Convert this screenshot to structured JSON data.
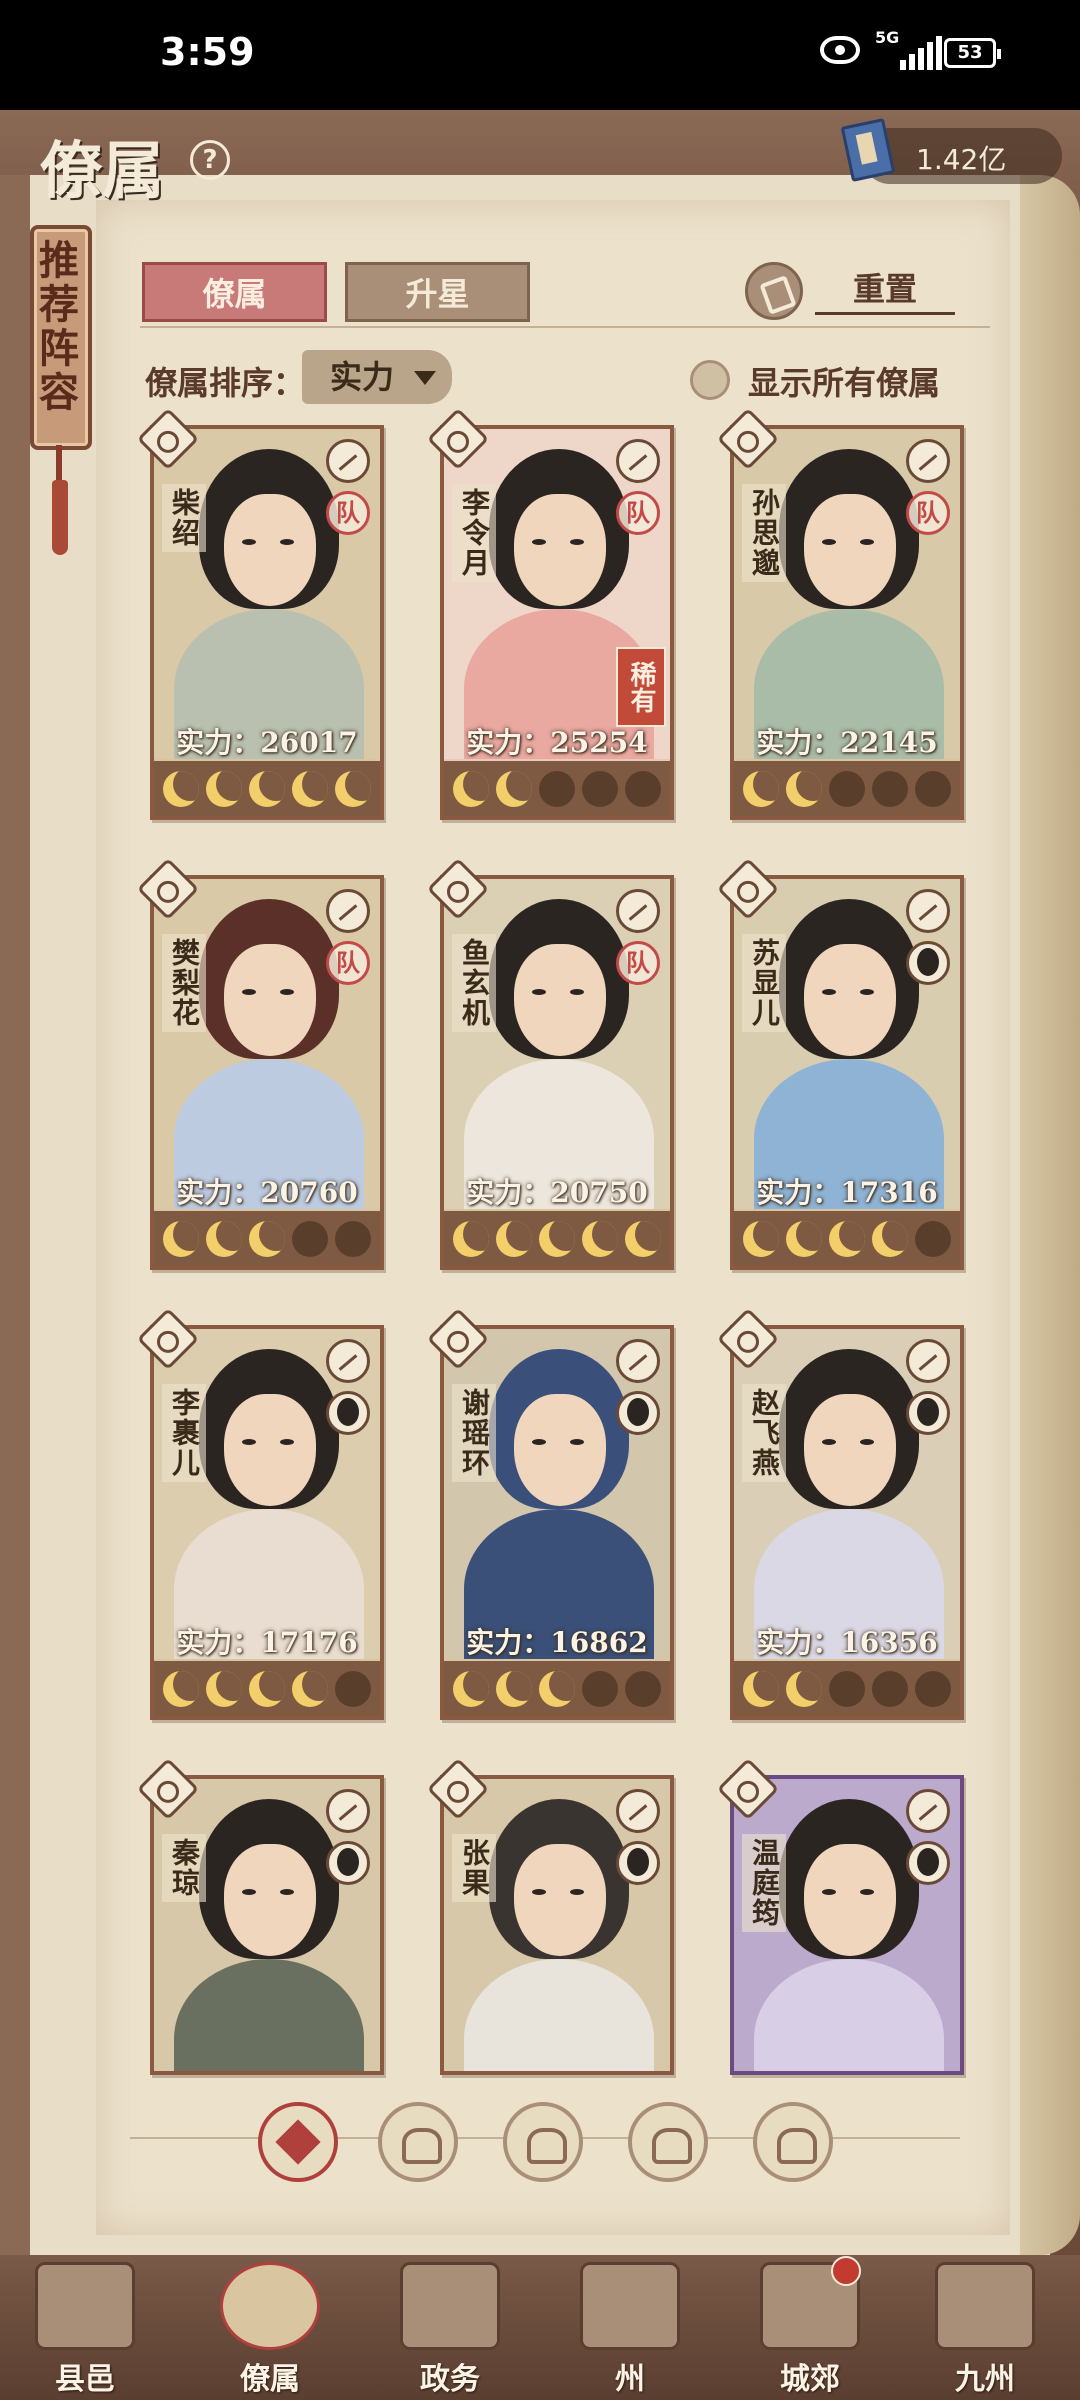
{
  "status_bar": {
    "time": "3:59",
    "network": "5G",
    "battery": "53"
  },
  "header": {
    "title": "僚属",
    "help": "?",
    "currency_value": "1.42亿"
  },
  "recommend_banner": "推荐阵容",
  "tabs": {
    "active": "僚属",
    "inactive": "升星",
    "reset": "重置"
  },
  "sort": {
    "label": "僚属排序：",
    "value": "实力"
  },
  "show_all_label": "显示所有僚属",
  "cards": [
    {
      "name": "柴绍",
      "power": "实力：26017",
      "stars": 5,
      "badge": "队"
    },
    {
      "name": "李令月",
      "power": "实力：25254",
      "stars": 2,
      "badge": "队",
      "rarity": "稀有"
    },
    {
      "name": "孙思邈",
      "power": "实力：22145",
      "stars": 2,
      "badge": "队"
    },
    {
      "name": "樊梨花",
      "power": "实力：20760",
      "stars": 3,
      "badge": "队"
    },
    {
      "name": "鱼玄机",
      "power": "实力：20750",
      "stars": 5,
      "badge": "队"
    },
    {
      "name": "苏显儿",
      "power": "实力：17316",
      "stars": 4
    },
    {
      "name": "李裹儿",
      "power": "实力：17176",
      "stars": 4
    },
    {
      "name": "谢瑶环",
      "power": "实力：16862",
      "stars": 3
    },
    {
      "name": "赵飞燕",
      "power": "实力：16356",
      "stars": 2
    },
    {
      "name": "秦琼"
    },
    {
      "name": "张果"
    },
    {
      "name": "温庭筠"
    }
  ],
  "bottom_nav": [
    {
      "label": "县邑"
    },
    {
      "label": "僚属"
    },
    {
      "label": "政务"
    },
    {
      "label": "州"
    },
    {
      "label": "城郊"
    },
    {
      "label": "九州"
    }
  ]
}
